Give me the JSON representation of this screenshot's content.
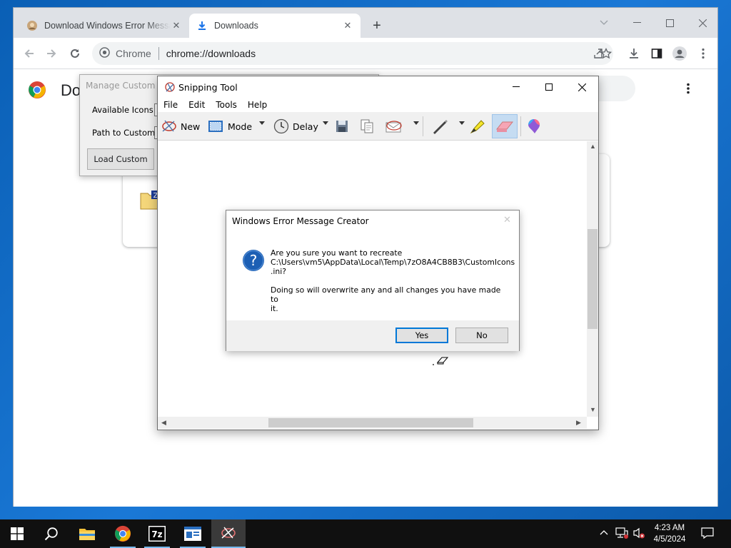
{
  "browser": {
    "tabs": [
      {
        "title": "Download Windows Error Messa"
      },
      {
        "title": "Downloads"
      }
    ],
    "omnibox": {
      "site": "Chrome",
      "url": "chrome://downloads"
    }
  },
  "downloads_page": {
    "title": "Do"
  },
  "manage_custom": {
    "title": "Manage Custom Ic",
    "available_label": "Available Icons:",
    "path_label": "Path to Custom:",
    "load_button": "Load Custom"
  },
  "snipping_tool": {
    "title": "Snipping Tool",
    "menu": [
      "File",
      "Edit",
      "Tools",
      "Help"
    ],
    "toolbar": {
      "new": "New",
      "mode": "Mode",
      "delay": "Delay"
    }
  },
  "error_dialog": {
    "title": "Windows Error Message Creator",
    "message": "Are you sure you want to recreate\nC:\\Users\\vm5\\AppData\\Local\\Temp\\7zO8A4CB8B3\\CustomIcons\n.ini?\n\nDoing so will overwrite any and all changes you have made to\nit.",
    "yes": "Yes",
    "no": "No"
  },
  "taskbar": {
    "apps": [
      "start",
      "search",
      "file-explorer",
      "chrome",
      "7-zip",
      "error-message-creator",
      "snipping-tool"
    ],
    "time": "4:23 AM",
    "date": "4/5/2024"
  },
  "colors": {
    "accent": "#0078d7",
    "desktop": "#1a78d6",
    "taskbar": "#101010"
  }
}
